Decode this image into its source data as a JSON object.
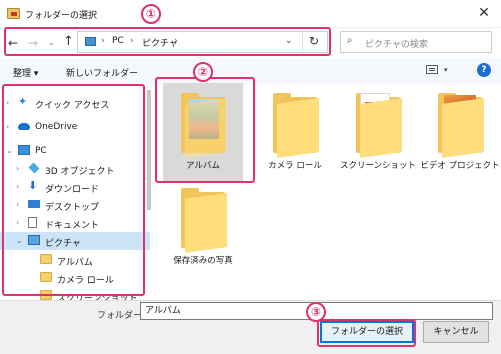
{
  "window": {
    "title": "フォルダーの選択",
    "close_glyph": "✕"
  },
  "address": {
    "back": "←",
    "forward": "→",
    "recent": "⌄",
    "up": "↑",
    "sep": "›",
    "path": [
      "PC",
      "ピクチャ"
    ],
    "dropdown": "⌄",
    "refresh": "↻"
  },
  "search": {
    "icon": "⌕",
    "placeholder": "ピクチャの検索"
  },
  "toolbar": {
    "organize_label": "整理 ▾",
    "new_folder_label": "新しいフォルダー",
    "view_dropdown": "▾",
    "help": "?"
  },
  "nav_tree": [
    {
      "label": "クイック アクセス",
      "arrow": "›",
      "icon": "star-icon",
      "selected": false
    },
    {
      "label": "OneDrive",
      "arrow": "›",
      "icon": "cloud-icon",
      "selected": false
    },
    {
      "label": "PC",
      "arrow": "⌄",
      "icon": "pc-icon",
      "selected": false
    },
    {
      "label": "3D オブジェクト",
      "arrow": "›",
      "icon": "cube-icon",
      "selected": false
    },
    {
      "label": "ダウンロード",
      "arrow": "›",
      "icon": "download-icon",
      "selected": false
    },
    {
      "label": "デスクトップ",
      "arrow": "›",
      "icon": "desktop-icon",
      "selected": false
    },
    {
      "label": "ドキュメント",
      "arrow": "›",
      "icon": "document-icon",
      "selected": false
    },
    {
      "label": "ピクチャ",
      "arrow": "⌄",
      "icon": "pictures-icon",
      "selected": true
    },
    {
      "label": "アルバム",
      "arrow": "",
      "icon": "folder-icon",
      "selected": false
    },
    {
      "label": "カメラ ロール",
      "arrow": "",
      "icon": "folder-icon",
      "selected": false
    },
    {
      "label": "スクリーンショット",
      "arrow": "",
      "icon": "folder-icon",
      "selected": false
    }
  ],
  "files": [
    {
      "label": "アルバム",
      "thumb": "photo",
      "selected": true
    },
    {
      "label": "カメラ ロール",
      "thumb": "empty",
      "selected": false
    },
    {
      "label": "スクリーンショット",
      "thumb": "screens",
      "selected": false
    },
    {
      "label": "ビデオ プロジェクト",
      "thumb": "autumn",
      "selected": false
    },
    {
      "label": "保存済みの写真",
      "thumb": "empty",
      "selected": false
    }
  ],
  "footer": {
    "folder_label": "フォルダー:",
    "folder_value": "アルバム",
    "select_button": "フォルダーの選択",
    "cancel_button": "キャンセル"
  },
  "callouts": [
    "①",
    "②",
    "③"
  ],
  "colors": {
    "callout": "#e0306f",
    "selection": "#cce4f7",
    "accent": "#0078d7"
  }
}
